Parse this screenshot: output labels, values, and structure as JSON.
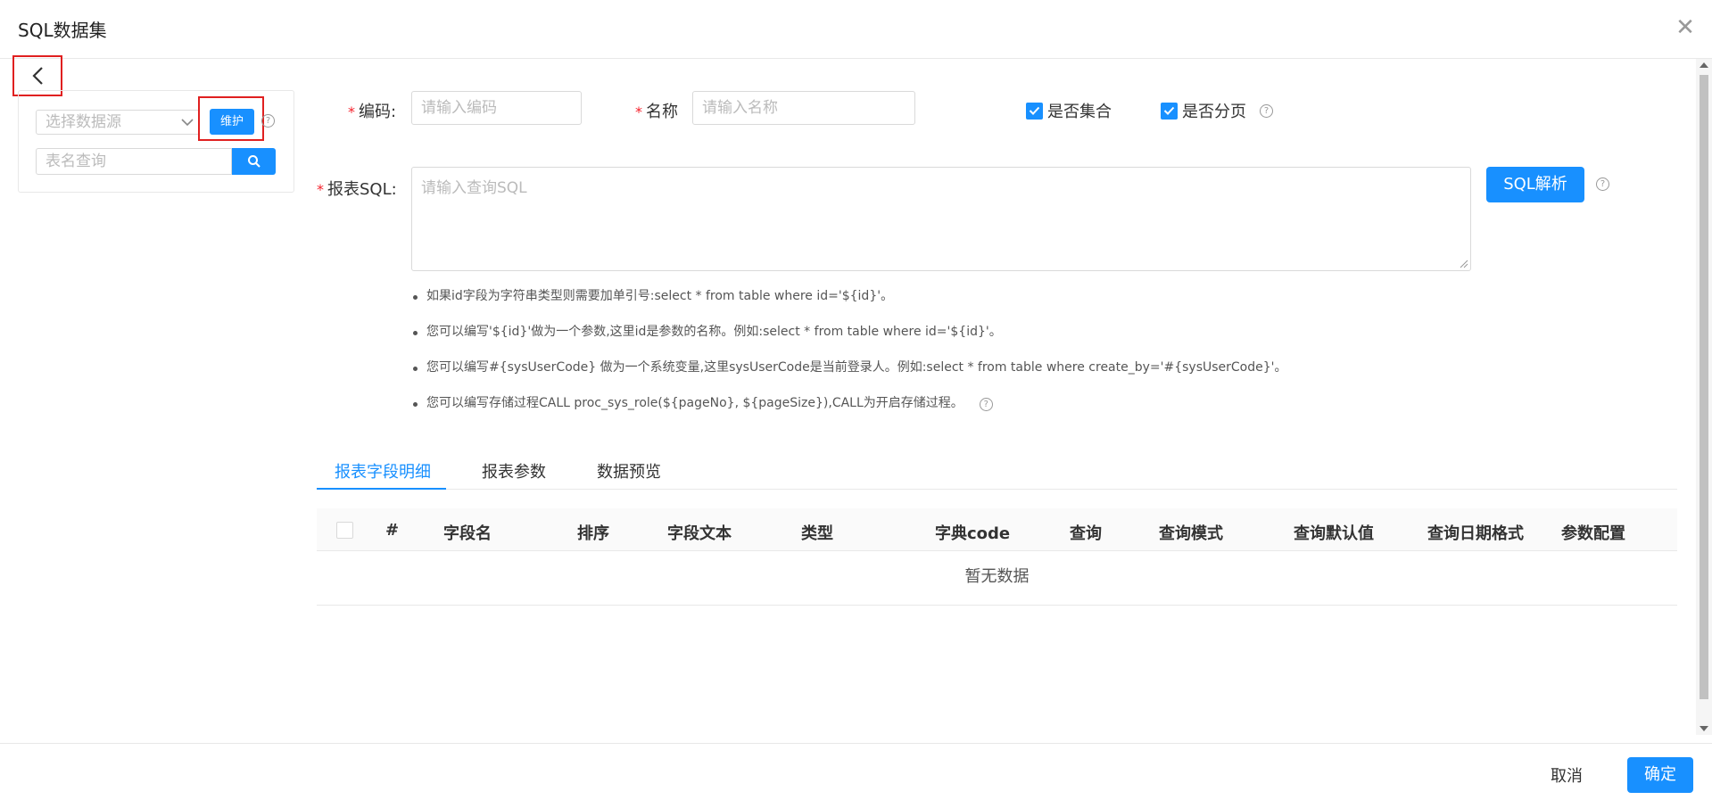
{
  "modal": {
    "title": "SQL数据集"
  },
  "left": {
    "datasource_placeholder": "选择数据源",
    "maintain_label": "维护",
    "table_search_placeholder": "表名查询"
  },
  "form": {
    "code_label": "编码:",
    "code_placeholder": "请输入编码",
    "name_label": "名称",
    "name_placeholder": "请输入名称",
    "is_collection_label": "是否集合",
    "is_collection_checked": true,
    "is_paging_label": "是否分页",
    "is_paging_checked": true,
    "sql_label": "报表SQL:",
    "sql_placeholder": "请输入查询SQL",
    "parse_label": "SQL解析"
  },
  "tips": [
    "如果id字段为字符串类型则需要加单引号:select * from table where id='${id}'。",
    "您可以编写'${id}'做为一个参数,这里id是参数的名称。例如:select * from table where id='${id}'。",
    "您可以编写#{sysUserCode} 做为一个系统变量,这里sysUserCode是当前登录人。例如:select * from table where create_by='#{sysUserCode}'。",
    "您可以编写存储过程CALL proc_sys_role(${pageNo}, ${pageSize}),CALL为开启存储过程。"
  ],
  "tabs": [
    "报表字段明细",
    "报表参数",
    "数据预览"
  ],
  "table": {
    "columns": [
      "#",
      "字段名",
      "排序",
      "字段文本",
      "类型",
      "字典code",
      "查询",
      "查询模式",
      "查询默认值",
      "查询日期格式",
      "参数配置"
    ],
    "empty_text": "暂无数据"
  },
  "footer": {
    "cancel_label": "取消",
    "ok_label": "确定"
  },
  "colors": {
    "primary": "#1890ff",
    "highlight_border": "#e02020"
  }
}
